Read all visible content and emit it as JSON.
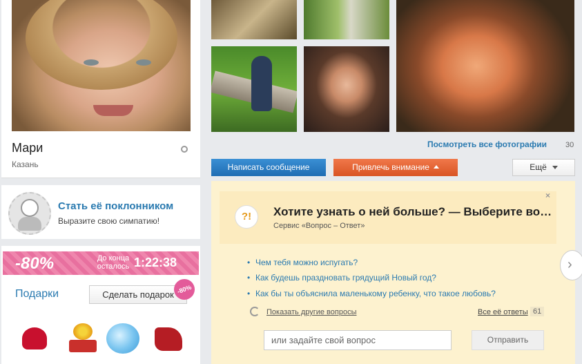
{
  "profile": {
    "name": "Мари",
    "city": "Казань"
  },
  "fan": {
    "title": "Стать её поклонником",
    "subtitle": "Выразите свою симпатию!"
  },
  "promo": {
    "percent": "-80%",
    "until_label": "До конца осталось",
    "timer": "1:22:38",
    "badge": "-80%"
  },
  "gifts": {
    "title": "Подарки",
    "make_gift_button": "Сделать подарок",
    "items": [
      "heart-chocolates-icon",
      "flowers-icon",
      "aquarium-icon",
      "boot-icon"
    ]
  },
  "photos": {
    "view_all_label": "Посмотреть все фотографии",
    "count": "30"
  },
  "actions": {
    "message_button": "Написать сообщение",
    "attract_button": "Привлечь внимание",
    "more_button": "Ещё"
  },
  "qa": {
    "heading": "Хотите узнать о ней больше? — Выберите вопрос",
    "service": "Сервис «Вопрос – Ответ»",
    "icon_text": "?!",
    "close": "×",
    "questions": [
      "Чем тебя можно испугать?",
      "Как будешь праздновать грядущий Новый год?",
      "Как бы ты объяснила маленькому ребенку, что такое любовь?"
    ],
    "show_other": "Показать другие вопросы",
    "all_answers": "Все её ответы",
    "answers_count": "61",
    "input_placeholder": "или задайте свой вопрос",
    "send_button": "Отправить"
  },
  "colors": {
    "link": "#2a7ab0",
    "blue_button": "#1f6db3",
    "red_button": "#d95424",
    "promo_pink": "#e8709f",
    "qa_background": "#fdf2cf"
  }
}
